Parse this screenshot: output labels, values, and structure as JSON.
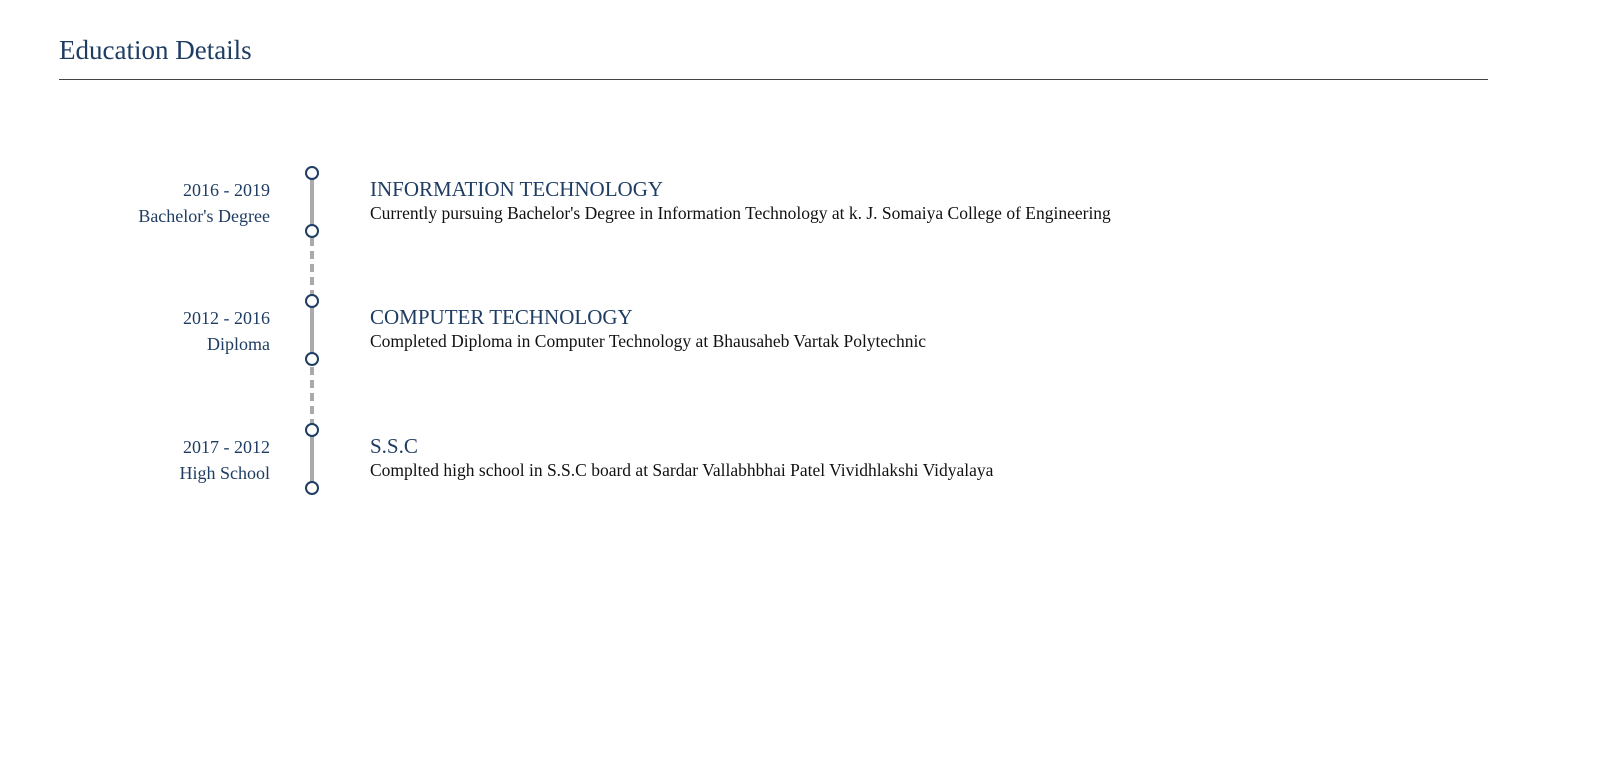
{
  "page": {
    "title": "Education Details"
  },
  "education": [
    {
      "years": "2016 - 2019",
      "level": "Bachelor's Degree",
      "title": "INFORMATION TECHNOLOGY",
      "description": "Currently pursuing Bachelor's Degree in Information Technology at k. J. Somaiya College of Engineering"
    },
    {
      "years": "2012 - 2016",
      "level": "Diploma",
      "title": "COMPUTER TECHNOLOGY",
      "description": "Completed Diploma in Computer Technology at Bhausaheb Vartak Polytechnic"
    },
    {
      "years": "2017 - 2012",
      "level": "High School",
      "title": "S.S.C",
      "description": "Complted high school in S.S.C board at Sardar Vallabhbhai Patel Vividhlakshi Vidyalaya"
    }
  ],
  "colors": {
    "accent": "#1f3d63",
    "rule": "#444444",
    "timeline_line": "#aaaaaa",
    "text": "#111111"
  }
}
